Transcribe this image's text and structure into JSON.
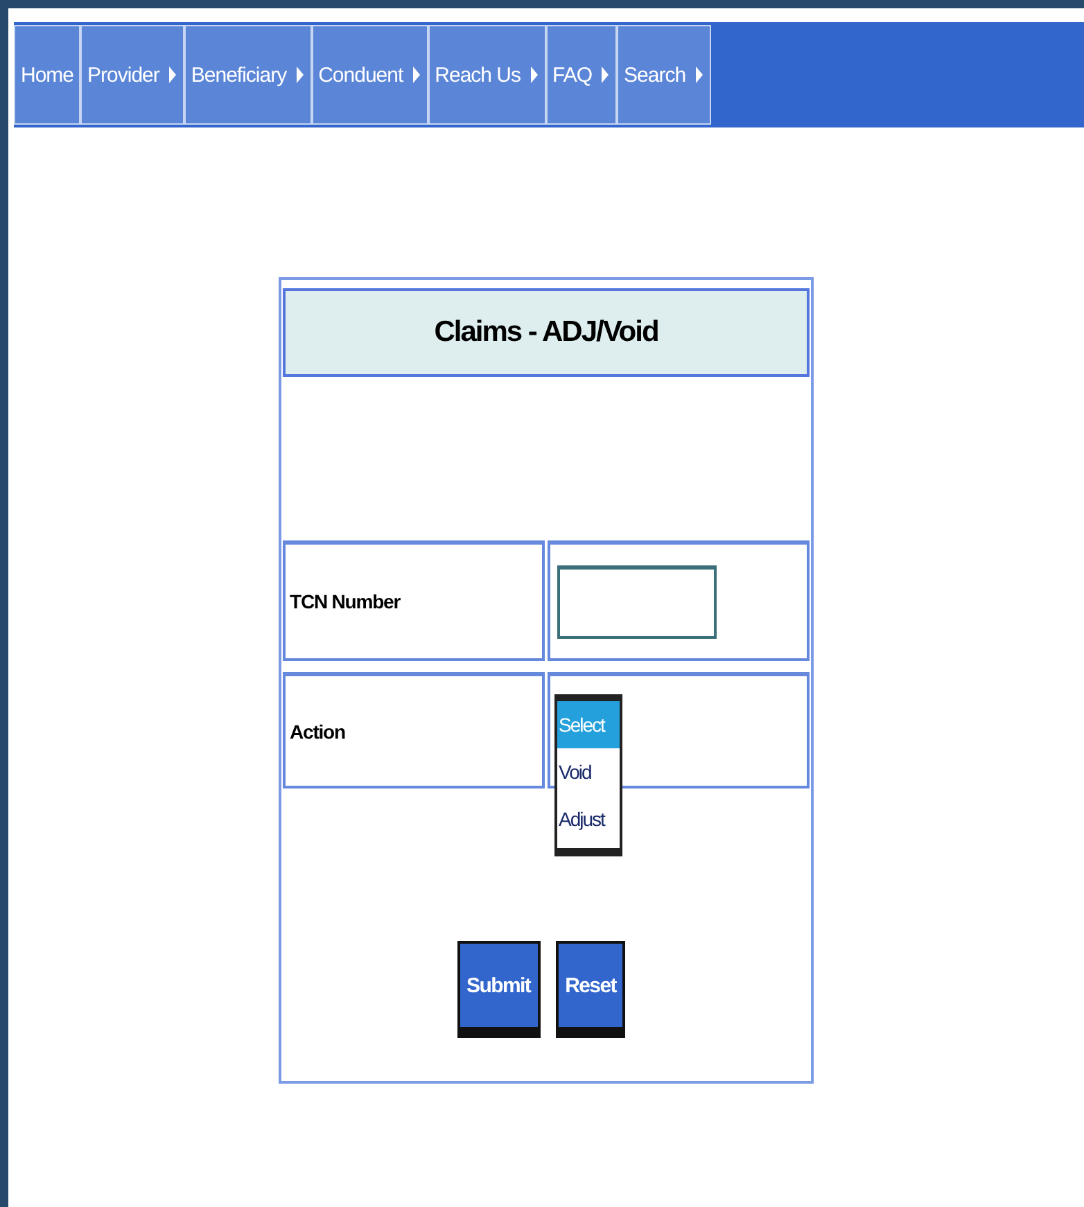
{
  "nav": [
    {
      "label": "Home",
      "has_arrow": false
    },
    {
      "label": "Provider",
      "has_arrow": true
    },
    {
      "label": "Beneficiary",
      "has_arrow": true
    },
    {
      "label": "Conduent",
      "has_arrow": true
    },
    {
      "label": "Reach Us",
      "has_arrow": true
    },
    {
      "label": "FAQ",
      "has_arrow": true
    },
    {
      "label": "Search",
      "has_arrow": true
    }
  ],
  "form": {
    "title": "Claims - ADJ/Void",
    "tcn": {
      "label": "TCN Number"
    },
    "action": {
      "label": "Action",
      "options": [
        {
          "label": "Select",
          "selected": true
        },
        {
          "label": "Void",
          "selected": false
        },
        {
          "label": "Adjust",
          "selected": false
        }
      ]
    },
    "buttons": [
      "Submit",
      "Reset"
    ]
  }
}
